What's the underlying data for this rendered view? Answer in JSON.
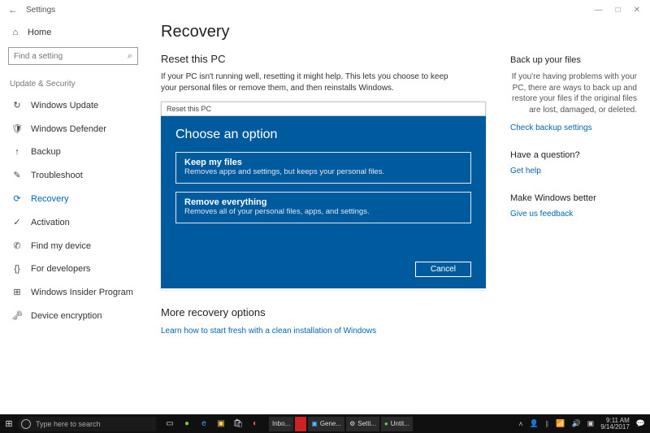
{
  "window": {
    "app_title": "Settings"
  },
  "sidebar": {
    "home": "Home",
    "search_placeholder": "Find a setting",
    "group": "Update & Security",
    "items": [
      {
        "icon": "↻",
        "label": "Windows Update"
      },
      {
        "icon": "🛡",
        "label": "Windows Defender"
      },
      {
        "icon": "↑",
        "label": "Backup"
      },
      {
        "icon": "✎",
        "label": "Troubleshoot"
      },
      {
        "icon": "⟳",
        "label": "Recovery"
      },
      {
        "icon": "✓",
        "label": "Activation"
      },
      {
        "icon": "✆",
        "label": "Find my device"
      },
      {
        "icon": "{}",
        "label": "For developers"
      },
      {
        "icon": "⊞",
        "label": "Windows Insider Program"
      },
      {
        "icon": "🗝",
        "label": "Device encryption"
      }
    ]
  },
  "main": {
    "title": "Recovery",
    "reset_title": "Reset this PC",
    "reset_desc": "If your PC isn't running well, resetting it might help. This lets you choose to keep your personal files or remove them, and then reinstalls Windows.",
    "more_title": "More recovery options",
    "more_link": "Learn how to start fresh with a clean installation of Windows"
  },
  "dialog": {
    "titlebar": "Reset this PC",
    "heading": "Choose an option",
    "options": [
      {
        "title": "Keep my files",
        "desc": "Removes apps and settings, but keeps your personal files."
      },
      {
        "title": "Remove everything",
        "desc": "Removes all of your personal files, apps, and settings."
      }
    ],
    "cancel": "Cancel"
  },
  "right": {
    "backup_head": "Back up your files",
    "backup_text": "If you're having problems with your PC, there are ways to back up and restore your files if the original files are lost, damaged, or deleted.",
    "backup_link": "Check backup settings",
    "question_head": "Have a question?",
    "question_link": "Get help",
    "better_head": "Make Windows better",
    "better_link": "Give us feedback"
  },
  "taskbar": {
    "search_placeholder": "Type here to search",
    "tasks": [
      {
        "label": "Inbo..."
      },
      {
        "label": ""
      },
      {
        "label": "Gene..."
      },
      {
        "label": "Setti..."
      },
      {
        "label": "Untit..."
      }
    ],
    "time": "9:11 AM",
    "date": "9/14/2017"
  }
}
